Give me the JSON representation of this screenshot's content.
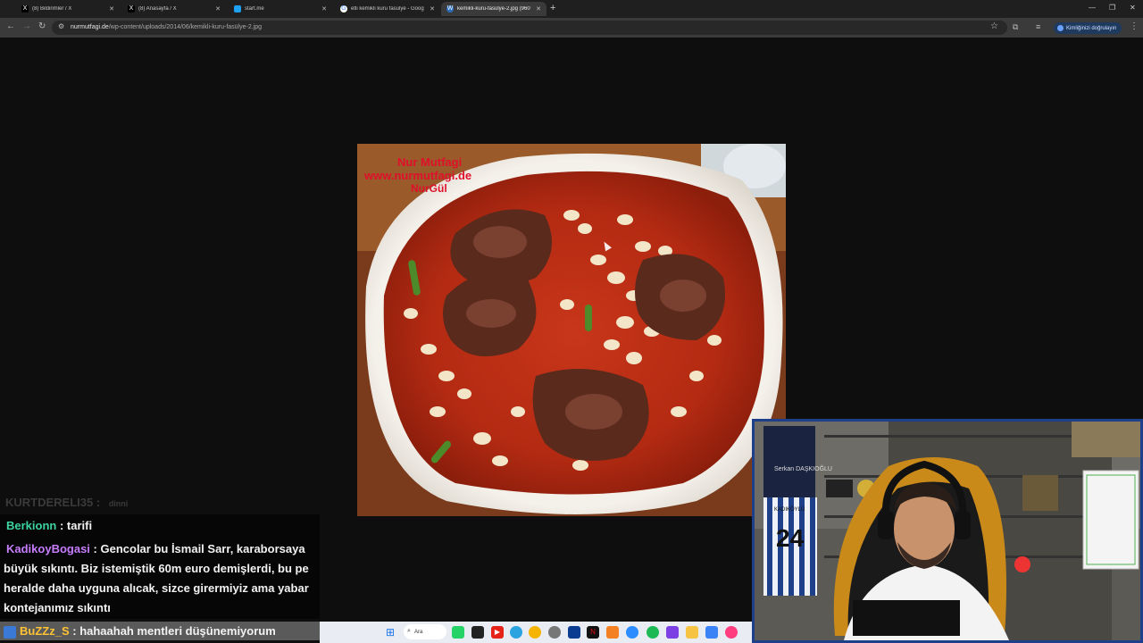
{
  "tabs": [
    {
      "icon": "x-logo-icon",
      "label": "(8) Bildirimler / X"
    },
    {
      "icon": "x-logo-icon",
      "label": "(8) Anasayfa / X"
    },
    {
      "icon": "startme-icon",
      "label": "start.me"
    },
    {
      "icon": "google-icon",
      "label": "etli kemikli kuru fasulye - Goog"
    },
    {
      "icon": "wordpress-icon",
      "label": "kemikli-kuru-fasülye-2.jpg (960"
    }
  ],
  "address_bar": {
    "domain": "nurmutfagi.de",
    "path": "/wp-content/uploads/2014/06/kemikli-kuru-fasülye-2.jpg"
  },
  "profile_button": "Kimliğinizi doğrulayın",
  "image": {
    "watermark_line1": "Nur Mutfagi",
    "watermark_line2": "www.nurmutfagi.de",
    "watermark_line3": "NurGül"
  },
  "chat": {
    "faded_user": "KURTDERELI35 :",
    "faded_msg": "dinni",
    "messages": [
      {
        "user": "Berkionn",
        "sep": " : ",
        "text": "tarifi"
      },
      {
        "user": "KadikoyBogasi",
        "sep": " : ",
        "text": "Gencolar bu İsmail Sarr, karaborsaya büyük sıkıntı. Biz istemiştik 60m euro demişlerdi, bu pe heralde daha uyguna alıcak, sizce girermiyiz ama yabar kontejanımız sıkıntı"
      },
      {
        "user": "BuZZz_S",
        "sep": " : ",
        "text": "hahaahah mentleri düşünemiyorum"
      }
    ]
  },
  "webcam": {
    "sign_name": "Serkan DAŞKIOĞLU",
    "jersey_name": "KADIKÖYLÜ",
    "jersey_number": "24"
  },
  "taskbar": {
    "search_label": "Ara"
  },
  "colors": {
    "teal_user": "#3cd4a0",
    "purple_user": "#c77dff",
    "gold_user": "#ffc233",
    "webcam_border": "#1e3f8a"
  }
}
